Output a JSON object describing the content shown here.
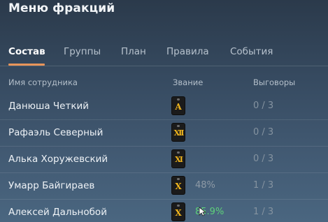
{
  "window": {
    "title": "Меню фракций"
  },
  "tabs": [
    {
      "label": "Состав",
      "active": true
    },
    {
      "label": "Группы",
      "active": false
    },
    {
      "label": "План",
      "active": false
    },
    {
      "label": "Правила",
      "active": false
    },
    {
      "label": "События",
      "active": false
    }
  ],
  "table": {
    "columns": [
      "Имя сотрудника",
      "Звание",
      "Выговоры"
    ],
    "rows": [
      {
        "name": "Данюша Четкий",
        "rank_glyph": "A",
        "progress": "",
        "reprimands": "0 / 3"
      },
      {
        "name": "Рафаэль Северный",
        "rank_glyph": "XII",
        "progress": "",
        "reprimands": "0 / 3"
      },
      {
        "name": "Алька Хоружевский",
        "rank_glyph": "XI",
        "progress": "",
        "reprimands": "0 / 3"
      },
      {
        "name": "Умарр Байгираев",
        "rank_glyph": "X",
        "progress": "48%",
        "reprimands": "1 / 3"
      },
      {
        "name": "Алексей Дальнобой",
        "rank_glyph": "X",
        "progress": "85.9%",
        "reprimands": "1 / 3"
      }
    ]
  },
  "colors": {
    "tab_accent": "#e9955a",
    "rank_gold": "#f0b51d",
    "progress_good": "#5ed27a"
  },
  "icons": {
    "rank_badge": "rank-insignia-icon",
    "cursor": "mouse-pointer-icon"
  }
}
